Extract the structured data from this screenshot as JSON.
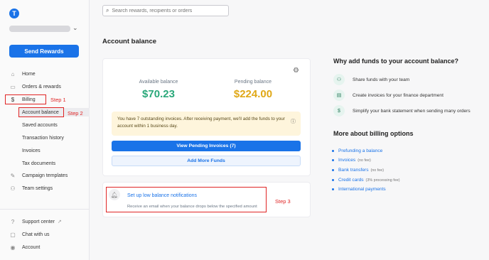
{
  "sidebar": {
    "logo_letter": "T",
    "send_rewards": "Send Rewards",
    "items": [
      {
        "label": "Home",
        "icon": "home-icon"
      },
      {
        "label": "Orders & rewards",
        "icon": "card-icon"
      },
      {
        "label": "Billing",
        "icon": "dollar-icon"
      },
      {
        "label": "Campaign templates",
        "icon": "template-icon"
      },
      {
        "label": "Team settings",
        "icon": "team-icon"
      }
    ],
    "billing_sub": [
      "Account balance",
      "Saved accounts",
      "Transaction history",
      "Invoices",
      "Tax documents"
    ],
    "bottom": [
      {
        "label": "Support center",
        "icon": "help-icon"
      },
      {
        "label": "Chat with us",
        "icon": "chat-icon"
      },
      {
        "label": "Account",
        "icon": "user-icon"
      }
    ]
  },
  "annotations": {
    "step1": "Step 1",
    "step2": "Step 2",
    "step3": "Step 3"
  },
  "search": {
    "placeholder": "Search rewards, recipients or orders"
  },
  "main": {
    "title": "Account balance",
    "available_label": "Available balance",
    "available_value": "$70.23",
    "pending_label": "Pending balance",
    "pending_value": "$224.00",
    "notice": "You have 7 outstanding invoices. After receiving payment, we'll add the funds to your account within 1 business day.",
    "view_pending": "View Pending Invoices (7)",
    "add_funds": "Add More Funds",
    "low_balance_link": "Set up low balance notifications",
    "low_balance_desc": "Receive an email when your balance drops below the specified amount"
  },
  "right": {
    "why_title": "Why add funds to your account balance?",
    "reasons": [
      {
        "text": "Share funds with your team",
        "icon": "team-icon"
      },
      {
        "text": "Create invoices for your finance department",
        "icon": "document-icon"
      },
      {
        "text": "Simplify your bank statement when sending many orders",
        "icon": "dollar-icon"
      }
    ],
    "more_title": "More about billing options",
    "options": [
      {
        "label": "Prefunding a balance",
        "note": ""
      },
      {
        "label": "Invoices",
        "note": "(no fee)"
      },
      {
        "label": "Bank transfers",
        "note": "(no fee)"
      },
      {
        "label": "Credit cards",
        "note": "(3% processing fee)"
      },
      {
        "label": "International payments",
        "note": ""
      }
    ]
  },
  "colors": {
    "brand": "#1a73e8",
    "balance": "#2aa87a",
    "pending": "#e0a817",
    "annotation": "#e02424"
  }
}
